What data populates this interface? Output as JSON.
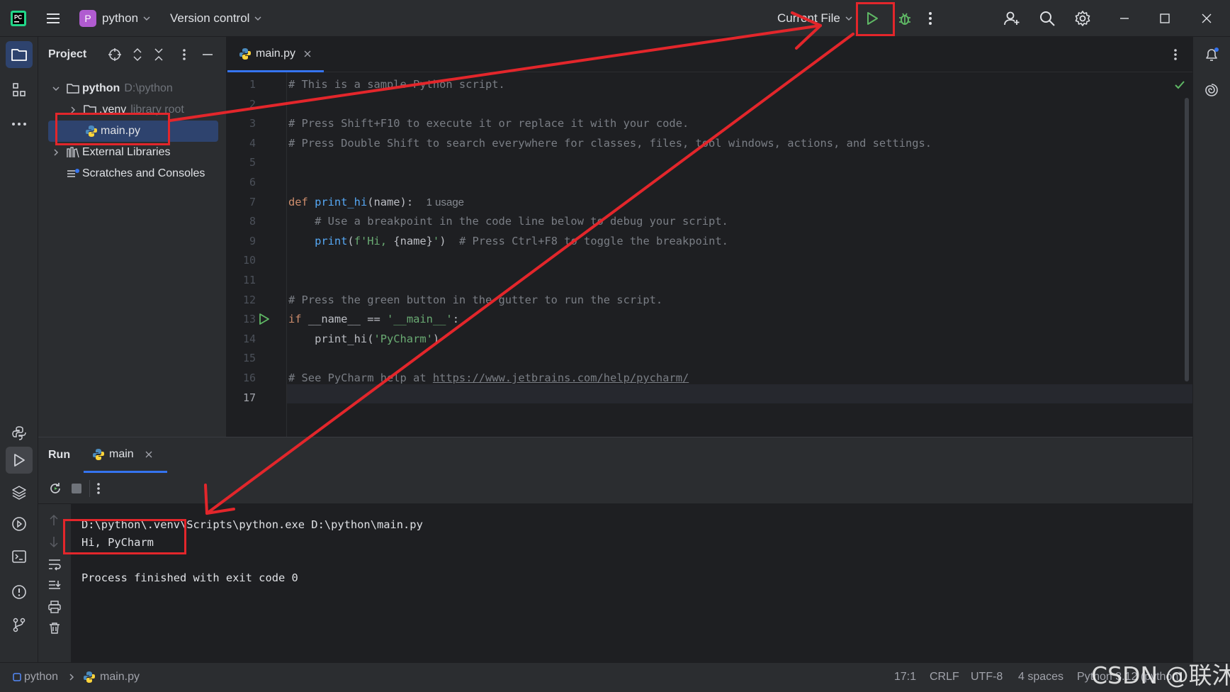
{
  "titlebar": {
    "project_badge": "P",
    "project_name": "python",
    "vcs_label": "Version control",
    "run_config": "Current File"
  },
  "project_panel": {
    "title": "Project",
    "tree": {
      "root_name": "python",
      "root_path": "D:\\python",
      "venv_name": ".venv",
      "venv_note": "library root",
      "file_name": "main.py",
      "external_libraries": "External Libraries",
      "scratches": "Scratches and Consoles"
    }
  },
  "editor": {
    "tab_label": "main.py",
    "line_numbers": [
      "1",
      "2",
      "3",
      "4",
      "5",
      "6",
      "7",
      "8",
      "9",
      "10",
      "11",
      "12",
      "13",
      "14",
      "15",
      "16",
      "17"
    ],
    "code": {
      "l1": "# This is a sample Python script.",
      "l3": "# Press Shift+F10 to execute it or replace it with your code.",
      "l4": "# Press Double Shift to search everywhere for classes, files, tool windows, actions, and settings.",
      "l7_kw": "def ",
      "l7_fn": "print_hi",
      "l7_rest": "(name):",
      "l7_hint": "1 usage",
      "l8": "    # Use a breakpoint in the code line below to debug your script.",
      "l9_fn": "    print",
      "l9_open": "(",
      "l9_str1": "f'Hi, ",
      "l9_brace": "{name}",
      "l9_str2": "'",
      "l9_close": ")",
      "l9_com": "  # Press Ctrl+F8 to toggle the breakpoint.",
      "l12": "# Press the green button in the gutter to run the script.",
      "l13_kw": "if ",
      "l13_rest": "__name__ == ",
      "l13_str": "'__main__'",
      "l13_end": ":",
      "l14_a": "    print_hi(",
      "l14_str": "'PyCharm'",
      "l14_b": ")",
      "l16_a": "# See PyCharm help at ",
      "l16_link": "https://www.jetbrains.com/help/pycharm/"
    }
  },
  "run_panel": {
    "title": "Run",
    "tab_label": "main",
    "output": [
      "D:\\python\\.venv\\Scripts\\python.exe D:\\python\\main.py",
      "Hi, PyCharm",
      "",
      "Process finished with exit code 0"
    ]
  },
  "statusbar": {
    "crumb_project": "python",
    "crumb_file": "main.py",
    "position": "17:1",
    "line_sep": "CRLF",
    "encoding": "UTF-8",
    "indent": "4 spaces",
    "interpreter": "Python 3.12 (python)"
  },
  "watermark": "CSDN @联沐",
  "colors": {
    "accent": "#3574f0",
    "annotation_red": "#e3262b",
    "run_green": "#5fb865"
  }
}
